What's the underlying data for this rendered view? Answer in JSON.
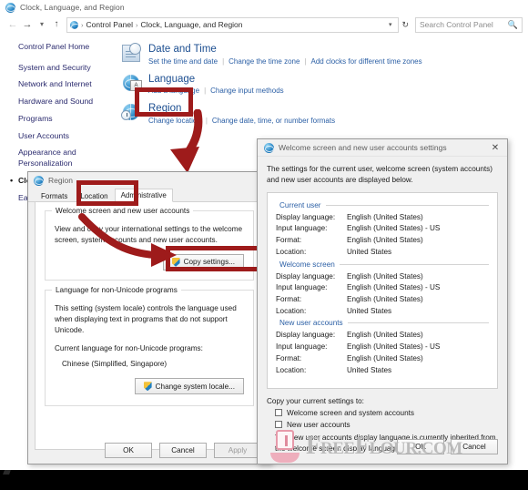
{
  "window": {
    "title": "Clock, Language, and Region",
    "title_icon": "control-panel-icon"
  },
  "address_bar": {
    "back_icon": "arrow-left-icon",
    "forward_icon": "arrow-right-icon",
    "history_icon": "chevron-down-icon",
    "up_icon": "arrow-up-icon",
    "path_icon": "control-panel-icon",
    "crumbs": [
      "Control Panel",
      "Clock, Language, and Region"
    ],
    "separator": "›",
    "dropdown_icon": "chevron-down-icon",
    "refresh_icon": "refresh-icon",
    "search_placeholder": "Search Control Panel",
    "search_icon": "magnifier-icon"
  },
  "sidebar": {
    "home": "Control Panel Home",
    "items": [
      {
        "label": "System and Security",
        "current": false
      },
      {
        "label": "Network and Internet",
        "current": false
      },
      {
        "label": "Hardware and Sound",
        "current": false
      },
      {
        "label": "Programs",
        "current": false
      },
      {
        "label": "User Accounts",
        "current": false
      },
      {
        "label": "Appearance and Personalization",
        "current": false
      },
      {
        "label": "Clock, Language, and Region",
        "current": true
      },
      {
        "label": "Ease of Access",
        "current": false
      }
    ]
  },
  "categories": [
    {
      "icon": "date-and-time-icon",
      "title": "Date and Time",
      "links": [
        "Set the time and date",
        "Change the time zone",
        "Add clocks for different time zones"
      ]
    },
    {
      "icon": "language-icon",
      "title": "Language",
      "links": [
        "Add a language",
        "Change input methods"
      ]
    },
    {
      "icon": "region-globe-icon",
      "title": "Region",
      "links": [
        "Change location",
        "Change date, time, or number formats"
      ]
    }
  ],
  "annotations": {
    "highlight_color": "#9e1b1b",
    "boxes": [
      "region-category-highlight",
      "administrative-tab-highlight",
      "copy-settings-highlight"
    ],
    "arrows": [
      "arrow-to-region-dialog",
      "arrow-to-copy-settings"
    ]
  },
  "region_dialog": {
    "title": "Region",
    "title_icon": "region-globe-icon",
    "tabs": [
      {
        "label": "Formats",
        "active": false
      },
      {
        "label": "Location",
        "active": false
      },
      {
        "label": "Administrative",
        "active": true
      }
    ],
    "welcome_group": {
      "legend": "Welcome screen and new user accounts",
      "description": "View and copy your international settings to the welcome screen, system accounts and new user accounts.",
      "button": "Copy settings...",
      "button_icon": "uac-shield-icon"
    },
    "nonunicode_group": {
      "legend": "Language for non-Unicode programs",
      "description": "This setting (system locale) controls the language used when displaying text in programs that do not support Unicode.",
      "current_label": "Current language for non-Unicode programs:",
      "current_value": "Chinese (Simplified, Singapore)",
      "button": "Change system locale...",
      "button_icon": "uac-shield-icon"
    },
    "footer": {
      "ok": "OK",
      "cancel": "Cancel",
      "apply": "Apply"
    }
  },
  "welcome_dialog": {
    "title": "Welcome screen and new user accounts settings",
    "title_icon": "region-globe-icon",
    "close_icon": "close-icon",
    "intro": "The settings for the current user, welcome screen (system accounts) and new user accounts are displayed below.",
    "sections": [
      {
        "heading": "Current user",
        "rows": [
          {
            "key": "Display language:",
            "value": "English (United States)"
          },
          {
            "key": "Input language:",
            "value": "English (United States) - US"
          },
          {
            "key": "Format:",
            "value": "English (United States)"
          },
          {
            "key": "Location:",
            "value": "United States"
          }
        ]
      },
      {
        "heading": "Welcome screen",
        "rows": [
          {
            "key": "Display language:",
            "value": "English (United States)"
          },
          {
            "key": "Input language:",
            "value": "English (United States) - US"
          },
          {
            "key": "Format:",
            "value": "English (United States)"
          },
          {
            "key": "Location:",
            "value": "United States"
          }
        ]
      },
      {
        "heading": "New user accounts",
        "rows": [
          {
            "key": "Display language:",
            "value": "English (United States)"
          },
          {
            "key": "Input language:",
            "value": "English (United States) - US"
          },
          {
            "key": "Format:",
            "value": "English (United States)"
          },
          {
            "key": "Location:",
            "value": "United States"
          }
        ]
      }
    ],
    "copy_label": "Copy your current settings to:",
    "checkboxes": [
      {
        "label": "Welcome screen and system accounts",
        "checked": false
      },
      {
        "label": "New user accounts",
        "checked": false
      }
    ],
    "note": "The new user accounts display language is currently inherited from the welcome screen display language.",
    "footer": {
      "ok": "OK",
      "cancel": "Cancel"
    }
  },
  "watermark": {
    "text_a": "F",
    "text_b": "REE",
    "text_c": "F",
    "text_d": "LOUR",
    "text_e": ".COM",
    "logo_icon": "flour-bag-icon"
  }
}
